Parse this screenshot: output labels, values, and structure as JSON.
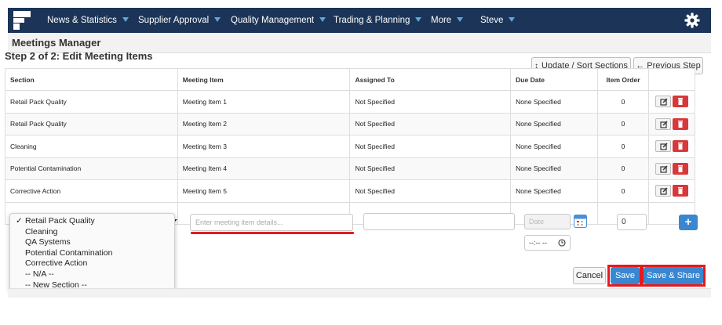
{
  "nav": {
    "items": [
      {
        "label": "News & Statistics"
      },
      {
        "label": "Supplier Approval"
      },
      {
        "label": "Quality Management"
      },
      {
        "label": "Trading & Planning"
      },
      {
        "label": "More"
      },
      {
        "label": "Steve"
      }
    ],
    "icons": {
      "logo": "app-logo",
      "settings": "gear-icon",
      "caret": "caret-down-icon"
    }
  },
  "page": {
    "title": "Meetings Manager"
  },
  "step": {
    "title": "Step 2 of 2: Edit Meeting Items",
    "update_sort_label": "Update / Sort Sections",
    "previous_label": "Previous Step"
  },
  "table": {
    "headers": {
      "section": "Section",
      "meeting_item": "Meeting Item",
      "assigned_to": "Assigned To",
      "due_date": "Due Date",
      "item_order": "Item Order"
    },
    "rows": [
      {
        "section": "Retail Pack Quality",
        "item": "Meeting Item 1",
        "assigned": "Not Specified",
        "due": "None Specified",
        "order": "0"
      },
      {
        "section": "Retail Pack Quality",
        "item": "Meeting Item 2",
        "assigned": "Not Specified",
        "due": "None Specified",
        "order": "0"
      },
      {
        "section": "Cleaning",
        "item": "Meeting Item 3",
        "assigned": "Not Specified",
        "due": "None Specified",
        "order": "0"
      },
      {
        "section": "Potential Contamination",
        "item": "Meeting Item 4",
        "assigned": "Not Specified",
        "due": "None Specified",
        "order": "0"
      },
      {
        "section": "Corrective Action",
        "item": "Meeting Item 5",
        "assigned": "Not Specified",
        "due": "None Specified",
        "order": "0"
      }
    ]
  },
  "new_item": {
    "details_placeholder": "Enter meeting item details...",
    "date_placeholder": "Date",
    "time_value": "--:-- --",
    "order_value": "0",
    "add_label": "+"
  },
  "section_dropdown": {
    "selected_mark": "✓",
    "options": [
      "Retail Pack Quality",
      "Cleaning",
      "QA Systems",
      "Potential Contamination",
      "Corrective Action",
      "-- N/A --",
      "-- New Section --"
    ]
  },
  "actions": {
    "cancel_label": "Cancel",
    "save_label": "Save",
    "save_share_label": "Save & Share"
  },
  "colors": {
    "navbar": "#1b3457",
    "caret": "#5aa7e4",
    "primary": "#3a86cf",
    "danger": "#d7383a",
    "highlight": "#e8191b"
  }
}
